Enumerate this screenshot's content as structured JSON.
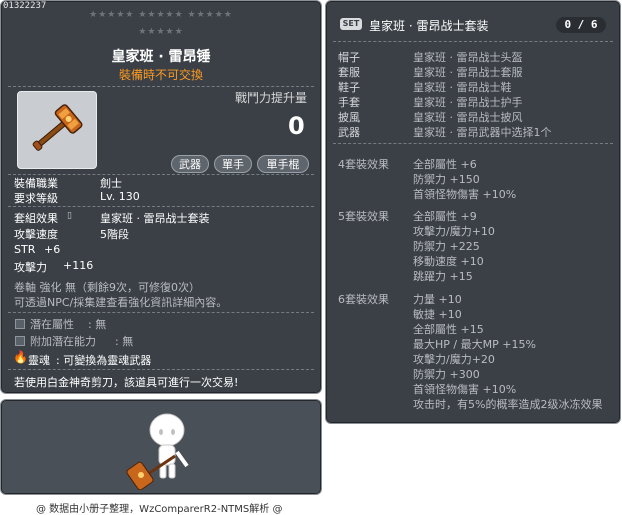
{
  "item": {
    "id": "01322237",
    "stars_row1": "★★★★★   ★★★★★   ★★★★★",
    "stars_row2": "★★★★★",
    "name": "皇家班 · 雷昂锤",
    "trade_note": "裝備時不可交換",
    "power_label": "戰鬥力提升量",
    "power_value": "0",
    "tags": [
      "武器",
      "單手",
      "單手棍"
    ],
    "job_label": "裝備職業",
    "job_value": "劍士",
    "level_label": "要求等級",
    "level_value": "Lv. 130",
    "set_label": "套組效果",
    "set_value": "皇家班 · 雷昂战士套装",
    "speed_label": "攻擊速度",
    "speed_value": "5階段",
    "str_label": "STR",
    "str_value": "+6",
    "atk_label": "攻擊力",
    "atk_value": "+116",
    "scroll_line": "卷軸 強化 無（剩餘9次，可修復0次）",
    "npc_line": "可透過NPC/採集建查看強化資訊詳細內容。",
    "potential_label": "潛在屬性",
    "potential_value": ": 無",
    "addpot_label": "附加潛在能力",
    "addpot_value": ": 無",
    "soul_label": "靈魂",
    "soul_value": ": 可變換為靈魂武器",
    "scissors_note": "若使用白金神奇剪刀，該道具可進行一次交易!"
  },
  "set": {
    "badge": "SET",
    "title": "皇家班 · 雷昂战士套装",
    "count": "0 / 6",
    "items": [
      {
        "slot": "帽子",
        "name": "皇家班 · 雷昂战士头盔"
      },
      {
        "slot": "套服",
        "name": "皇家班 · 雷昂战士套服"
      },
      {
        "slot": "鞋子",
        "name": "皇家班 · 雷昂战士鞋"
      },
      {
        "slot": "手套",
        "name": "皇家班 · 雷昂战士护手"
      },
      {
        "slot": "披風",
        "name": "皇家班 · 雷昂战士披风"
      },
      {
        "slot": "武器",
        "name": "皇家班 · 雷昂武器中选择1个"
      }
    ],
    "effects": [
      {
        "head": "4套裝效果",
        "lines": [
          "全部屬性 +6",
          "防禦力 +150",
          "首領怪物傷害 +10%"
        ]
      },
      {
        "head": "5套裝效果",
        "lines": [
          "全部屬性 +9",
          "攻擊力/魔力+10",
          "防禦力 +225",
          "移動速度 +10",
          "跳躍力 +15"
        ]
      },
      {
        "head": "6套裝效果",
        "lines": [
          "力量 +10",
          "敏捷 +10",
          "全部屬性 +15",
          "最大HP / 最大MP +15%",
          "攻擊力/魔力+20",
          "防禦力 +300",
          "首領怪物傷害 +10%",
          "攻击时，有5%的概率造成2级冰冻效果"
        ]
      }
    ]
  },
  "footer": "@ 数据由小册子整理，WzComparerR2-NTMS解析 @"
}
